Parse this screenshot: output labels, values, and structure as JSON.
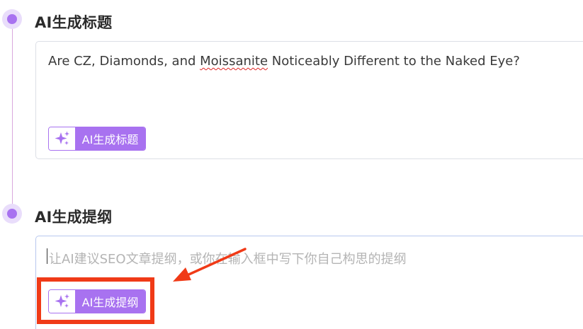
{
  "sections": [
    {
      "title": "AI生成标题",
      "content_before": "Are CZ, Diamonds, and ",
      "content_flagged": "Moissanite",
      "content_after": " Noticeably Different to the Naked Eye?",
      "button_label": "AI生成标题",
      "button_icon": "sparkle-icon"
    },
    {
      "title": "AI生成提纲",
      "placeholder": "让AI建议SEO文章提纲，或你在输入框中写下你自己构思的提纲",
      "button_label": "AI生成提纲",
      "button_icon": "sparkle-icon"
    }
  ],
  "colors": {
    "accent": "#a872f0",
    "annotation": "#f03a17"
  }
}
